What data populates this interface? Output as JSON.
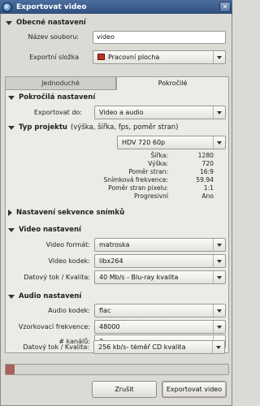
{
  "window": {
    "title": "Exportovat video"
  },
  "general": {
    "header": "Obecné nastavení",
    "filename_label": "Název souboru:",
    "filename_value": "video",
    "folder_label": "Exportní složka",
    "folder_value": "Pracovní plocha"
  },
  "tabs": [
    {
      "label": "Jednoduché",
      "active": false
    },
    {
      "label": "Pokročilé",
      "active": true
    }
  ],
  "advanced": {
    "header": "Pokročilá nastavení",
    "export_to_label": "Exportovat do:",
    "export_to_value": "Video a audio"
  },
  "project": {
    "header": "Typ projektu",
    "header_sub": "(výška, šířka, fps, poměr stran)",
    "profile_value": "HDV 720 60p",
    "info": [
      {
        "label": "Šířka:",
        "value": "1280"
      },
      {
        "label": "Výška:",
        "value": "720"
      },
      {
        "label": "Poměr stran:",
        "value": "16:9"
      },
      {
        "label": "Snímková frekvence:",
        "value": "59.94"
      },
      {
        "label": "Poměr stran pixelu:",
        "value": "1:1"
      },
      {
        "label": "Progresivní",
        "value": "Ano"
      }
    ]
  },
  "sequence": {
    "header": "Nastavení sekvence snímků"
  },
  "video": {
    "header": "Video nastavení",
    "format_label": "Video formát:",
    "format_value": "matroska",
    "codec_label": "Video kodek:",
    "codec_value": "libx264",
    "bitrate_label": "Datový tok / Kvalita:",
    "bitrate_value": "40 Mb/s - Blu-ray kvalita"
  },
  "audio": {
    "header": "Audio nastavení",
    "codec_label": "Audio kodek:",
    "codec_value": "flac",
    "samplerate_label": "Vzorkovací frekvence:",
    "samplerate_value": "48000",
    "channels_label": "# kanálů:",
    "channels_value": "2",
    "bitrate_label": "Datový tok / Kvalita:",
    "bitrate_value": "256 kb/s- téměř CD kvalita"
  },
  "progress": {
    "value": 0.04,
    "color": "#a8625e"
  },
  "buttons": {
    "cancel": "Zrušit",
    "export": "Exportovat video"
  }
}
